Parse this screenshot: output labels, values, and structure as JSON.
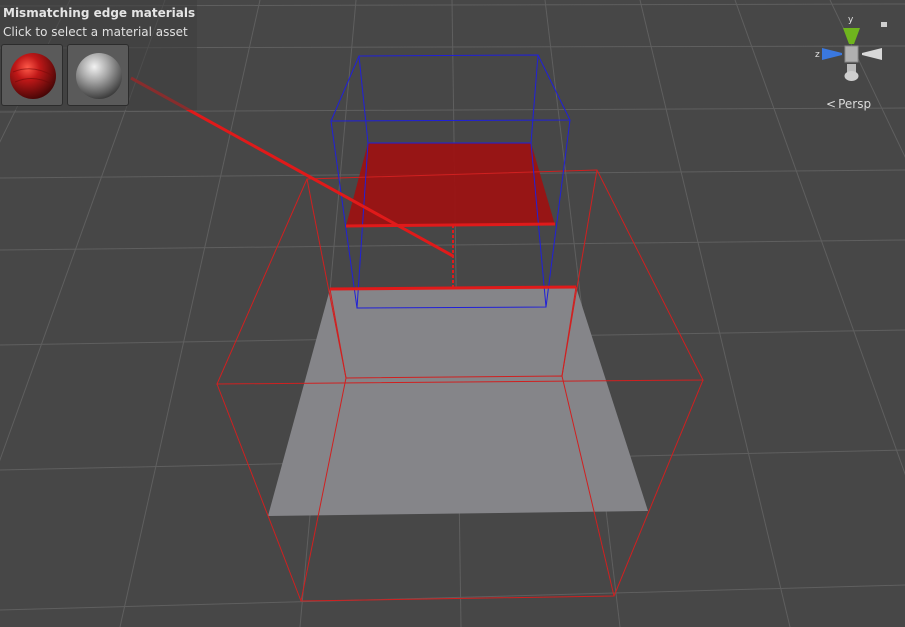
{
  "overlay": {
    "title": "Mismatching edge materials",
    "subtitle": "Click to select a material asset",
    "materials": [
      {
        "name": "red-material",
        "color": "#b01818"
      },
      {
        "name": "grey-material",
        "color": "#9a9a9a"
      }
    ]
  },
  "gizmo": {
    "y_label": "y",
    "z_label": "z",
    "projection_label": "Persp",
    "projection_icon": "<"
  },
  "colors": {
    "background": "#474747",
    "grid": "#5e5e5e",
    "edge_red": "#e01a1a",
    "bounds_red": "#d02020",
    "bounds_blue": "#2020d8",
    "red_face": "#a01010",
    "grey_face": "#858589",
    "gizmo_green": "#6fb51e",
    "gizmo_blue": "#3a78e0"
  }
}
